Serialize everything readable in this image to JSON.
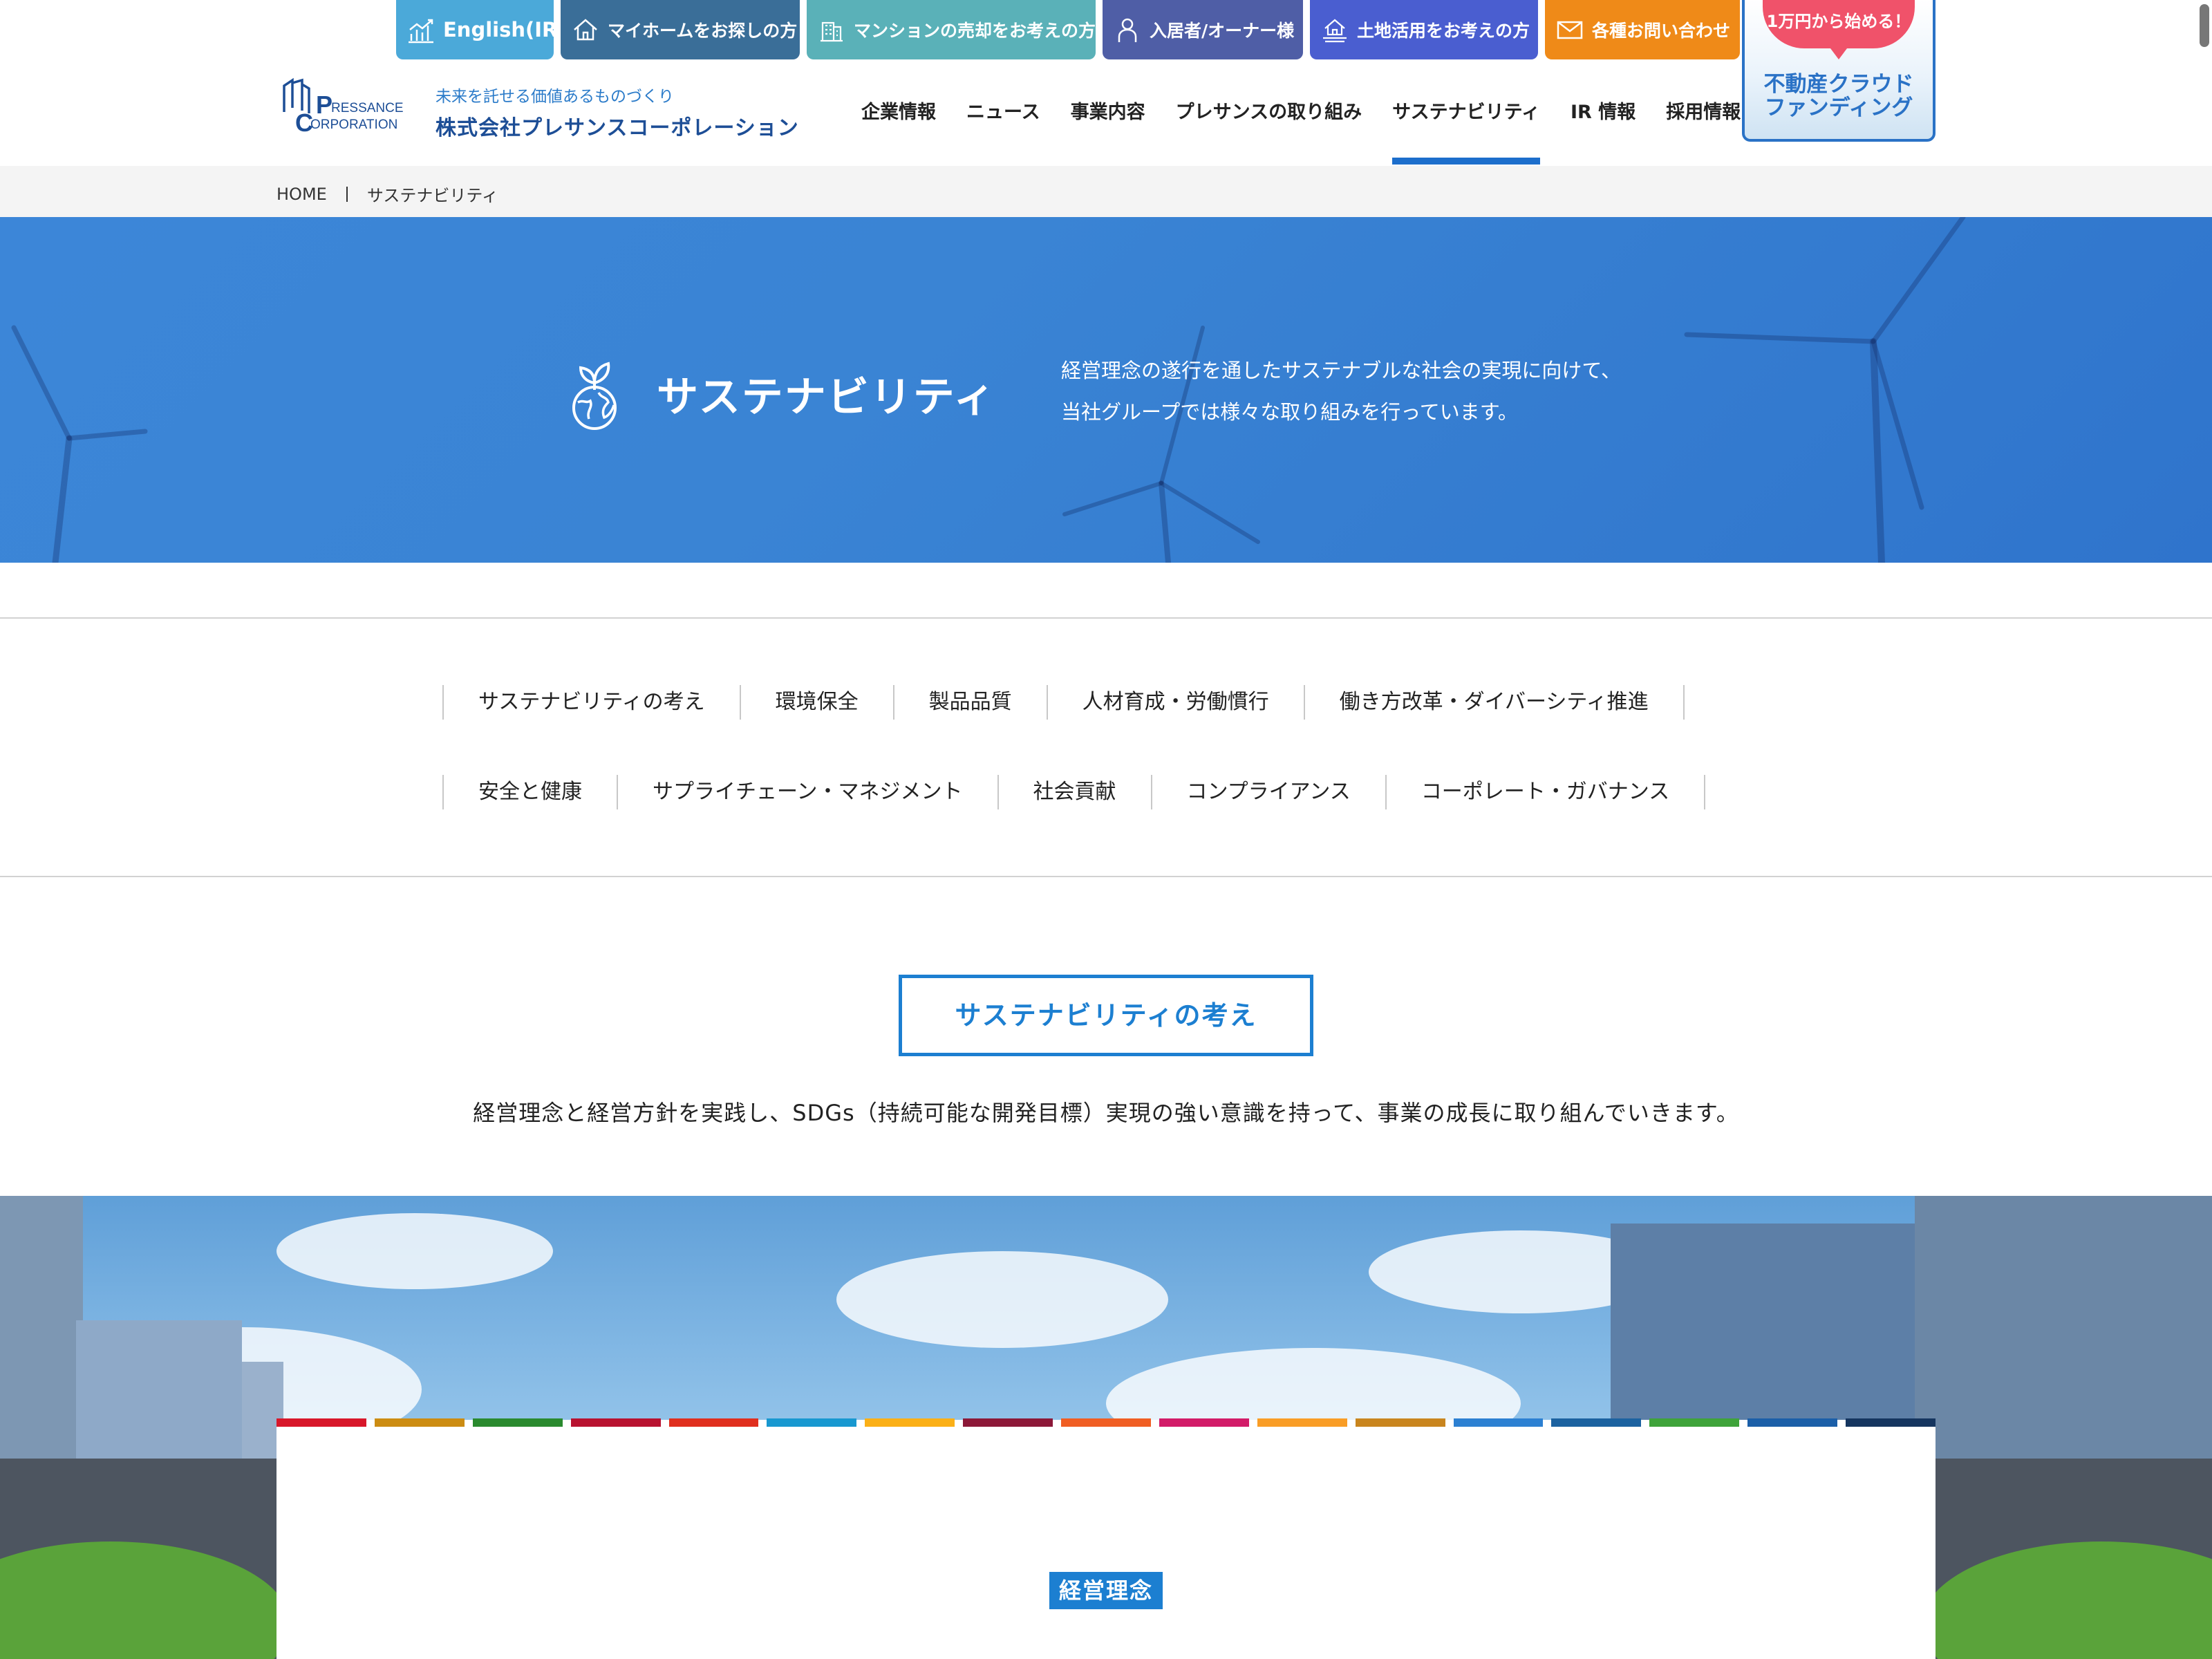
{
  "topbar": {
    "english": "English(IR)",
    "home_search": "マイホームをお探しの方",
    "mansion_sell": "マンションの売却をお考えの方",
    "owner": "入居者/オーナー様",
    "land": "土地活用をお考えの方",
    "contact": "各種お問い合わせ"
  },
  "crowdfunding": {
    "badge": "1万円から始める！",
    "title_line1": "不動産クラウド",
    "title_line2": "ファンディング"
  },
  "header": {
    "logo_text_1": "RESSANCE",
    "logo_text_2": "ORPORATION",
    "tagline": "未来を託せる価値あるものづくり",
    "company_name": "株式会社プレサンスコーポレーション"
  },
  "nav": {
    "items": [
      "企業情報",
      "ニュース",
      "事業内容",
      "プレサンスの取り組み",
      "サステナビリティ",
      "IR 情報",
      "採用情報"
    ],
    "active": "サステナビリティ"
  },
  "breadcrumb": {
    "home": "HOME",
    "current": "サステナビリティ"
  },
  "hero": {
    "title": "サステナビリティ",
    "desc_line1": "経営理念の遂行を通したサステナブルな社会の実現に向けて、",
    "desc_line2": "当社グループでは様々な取り組みを行っています。"
  },
  "subnav": {
    "row1": [
      "サステナビリティの考え",
      "環境保全",
      "製品品質",
      "人材育成・労働慣行",
      "働き方改革・ダイバーシティ推進"
    ],
    "row2": [
      "安全と健康",
      "サプライチェーン・マネジメント",
      "社会貢献",
      "コンプライアンス",
      "コーポレート・ガバナンス"
    ]
  },
  "section": {
    "title": "サステナビリティの考え",
    "lead": "経営理念と経営方針を実践し、SDGs（持続可能な開発目標）実現の強い意識を持って、事業の成長に取り組んでいきます。",
    "card_label": "経営理念"
  },
  "colors": {
    "accent": "#1c7fd1",
    "sdg": [
      "#d8172a",
      "#cc8c12",
      "#2a8a2e",
      "#b81230",
      "#e02f1e",
      "#1898d0",
      "#fbb017",
      "#8c1838",
      "#f05e23",
      "#d21b68",
      "#f99d26",
      "#c9851e",
      "#2c80d2",
      "#1c62a0",
      "#3fa33a",
      "#1b5fa8",
      "#15355f"
    ]
  }
}
